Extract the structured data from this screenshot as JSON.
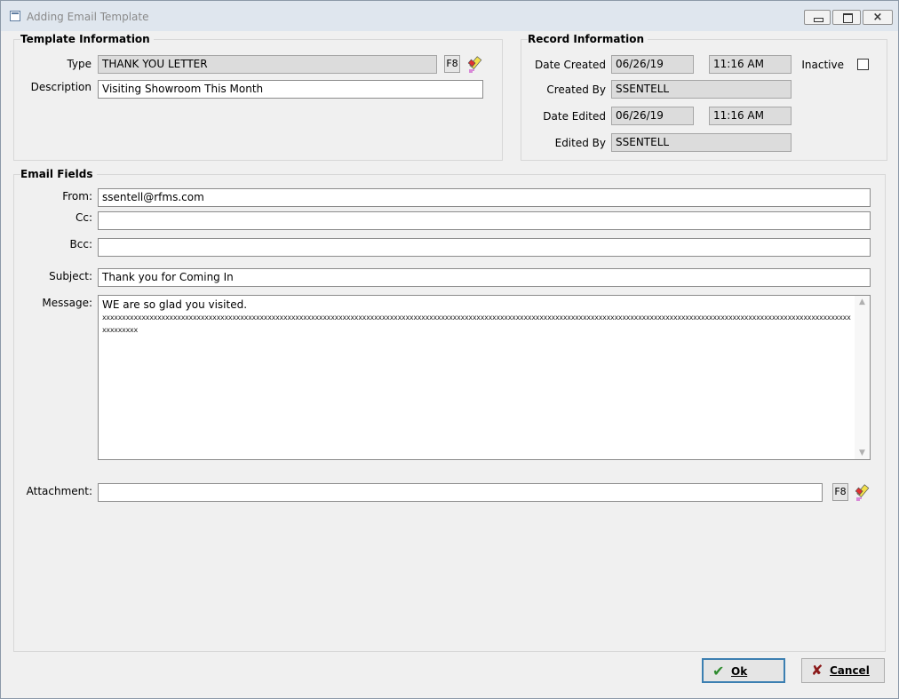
{
  "window": {
    "title": "Adding Email Template"
  },
  "template_info": {
    "title": "Template Information",
    "type_label": "Type",
    "type_value": "THANK YOU LETTER",
    "f8_label": "F8",
    "description_label": "Description",
    "description_value": "Visiting Showroom This Month"
  },
  "record_info": {
    "title": "Record Information",
    "date_created_label": "Date Created",
    "date_created": "06/26/19",
    "time_created": "11:16 AM",
    "inactive_label": "Inactive",
    "inactive_checked": false,
    "created_by_label": "Created By",
    "created_by": "SSENTELL",
    "date_edited_label": "Date Edited",
    "date_edited": "06/26/19",
    "time_edited": "11:16 AM",
    "edited_by_label": "Edited By",
    "edited_by": "SSENTELL"
  },
  "email_fields": {
    "title": "Email Fields",
    "from_label": "From:",
    "from_value": "ssentell@rfms.com",
    "cc_label": "Cc:",
    "cc_value": "",
    "bcc_label": "Bcc:",
    "bcc_value": "",
    "subject_label": "Subject:",
    "subject_value": "Thank you for Coming In",
    "message_label": "Message:",
    "message_line1": "WE are so glad you visited.",
    "message_line2": "xxxxxxxxxxxxxxxxxxxxxxxxxxxxxxxxxxxxxxxxxxxxxxxxxxxxxxxxxxxxxxxxxxxxxxxxxxxxxxxxxxxxxxxxxxxxxxxxxxxxxxxxxxxxxxxxxxxxxxxxxxxxxxxxxxxxxxxxxxxxxxxxxxxxxxxxxxxxxxxxxxxxxxxxxxxxxxxxxxxxxxxxxxxxxxxxxxxxxxx",
    "attachment_label": "Attachment:",
    "attachment_value": "",
    "f8_label": "F8"
  },
  "buttons": {
    "ok_label": "Ok",
    "cancel_label": "Cancel"
  },
  "icons": {
    "ok": "checkmark-icon",
    "cancel": "x-icon",
    "clear": "eraser-icon"
  },
  "colors": {
    "ok_check": "#2e8b2e",
    "cancel_x": "#8b1a1a",
    "ok_border": "#3c7fb1"
  }
}
